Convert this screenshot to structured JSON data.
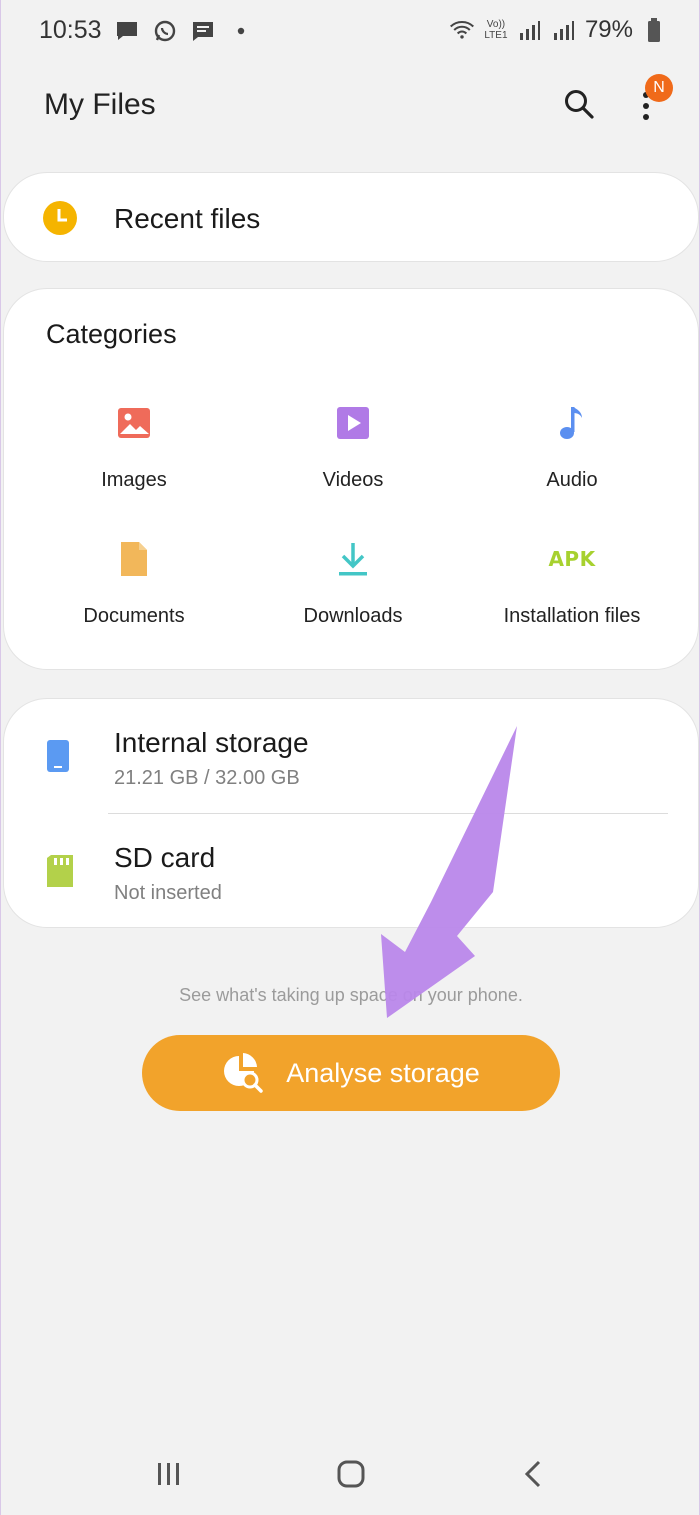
{
  "status_bar": {
    "time": "10:53",
    "battery": "79%",
    "network_label": "Vo)) LTE1"
  },
  "header": {
    "title": "My Files",
    "notification_badge": "N"
  },
  "recent": {
    "label": "Recent files"
  },
  "categories": {
    "title": "Categories",
    "items": [
      {
        "label": "Images",
        "icon": "image-icon",
        "color": "#ef6b5a"
      },
      {
        "label": "Videos",
        "icon": "video-icon",
        "color": "#b07ae6"
      },
      {
        "label": "Audio",
        "icon": "music-note-icon",
        "color": "#5b8ff0"
      },
      {
        "label": "Documents",
        "icon": "document-icon",
        "color": "#f2b75a"
      },
      {
        "label": "Downloads",
        "icon": "download-icon",
        "color": "#43c6c6"
      },
      {
        "label": "Installation files",
        "icon": "apk-icon",
        "badge_text": "APK",
        "color": "#a7d12f"
      }
    ]
  },
  "storage": {
    "internal": {
      "name": "Internal storage",
      "usage": "21.21 GB / 32.00 GB",
      "icon": "phone-icon",
      "color": "#5b9af2"
    },
    "sd": {
      "name": "SD card",
      "status": "Not inserted",
      "icon": "sd-card-icon",
      "color": "#b3d14a"
    }
  },
  "hint": {
    "text": "See what's taking up space on your phone."
  },
  "analyse": {
    "label": "Analyse storage",
    "color": "#f2a32b"
  },
  "annotation": {
    "arrow_color": "#b987ea"
  },
  "nav": {
    "recents": "recents-icon",
    "home": "home-icon",
    "back": "back-icon"
  }
}
